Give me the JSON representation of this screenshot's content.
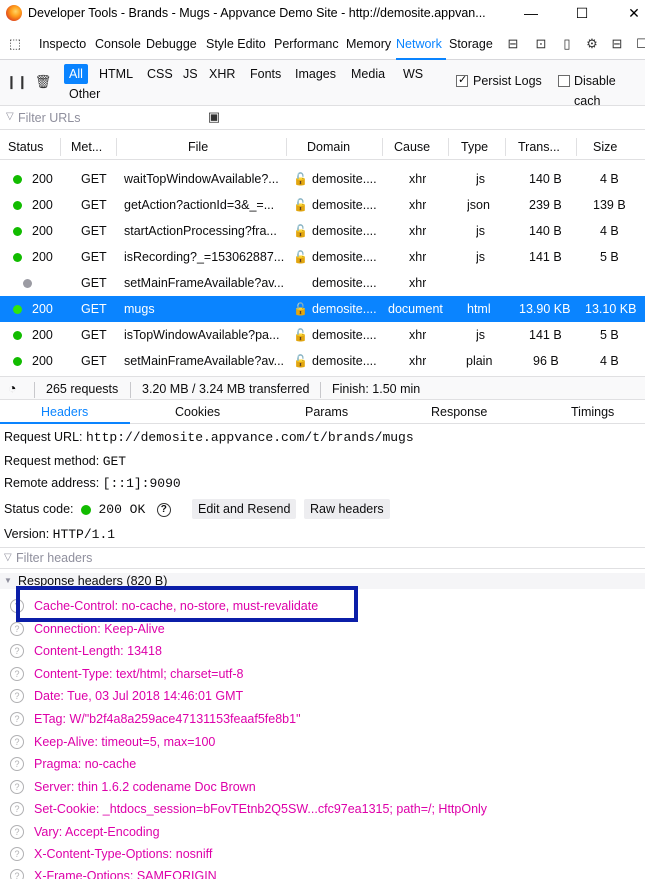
{
  "window": {
    "title": "Developer Tools - Brands - Mugs - Appvance Demo Site - http://demosite.appvan..."
  },
  "toolbox": {
    "tabs": [
      {
        "label": "Inspecto",
        "selected": false
      },
      {
        "label": "Console",
        "selected": false
      },
      {
        "label": "Debugge",
        "selected": false
      },
      {
        "label": "Style Edito",
        "selected": false
      },
      {
        "label": "Performanc",
        "selected": false
      },
      {
        "label": "Memory",
        "selected": false
      },
      {
        "label": "Network",
        "selected": true
      },
      {
        "label": "Storage",
        "selected": false
      }
    ]
  },
  "network_toolbar": {
    "filters": [
      "All",
      "HTML",
      "CSS",
      "JS",
      "XHR",
      "Fonts",
      "Images",
      "Media",
      "WS",
      "Other"
    ],
    "active_filter": "All",
    "persist_logs_label": "Persist Logs",
    "persist_logs_checked": true,
    "disable_cache_label": "Disable cach",
    "disable_cache_checked": false,
    "filter_urls_placeholder": "Filter URLs"
  },
  "columns": [
    "Status",
    "Met...",
    "File",
    "Domain",
    "Cause",
    "Type",
    "Trans...",
    "Size"
  ],
  "requests": [
    {
      "status": "200",
      "method": "GET",
      "file": "waitTopWindowAvailable?...",
      "domain": "demosite....",
      "cause": "xhr",
      "type": "js",
      "transferred": "140 B",
      "size": "4 B",
      "insecure": true,
      "dot": "green",
      "selected": false
    },
    {
      "status": "200",
      "method": "GET",
      "file": "getAction?actionId=3&_=...",
      "domain": "demosite....",
      "cause": "xhr",
      "type": "json",
      "transferred": "239 B",
      "size": "139 B",
      "insecure": true,
      "dot": "green",
      "selected": false
    },
    {
      "status": "200",
      "method": "GET",
      "file": "startActionProcessing?fra...",
      "domain": "demosite....",
      "cause": "xhr",
      "type": "js",
      "transferred": "140 B",
      "size": "4 B",
      "insecure": true,
      "dot": "green",
      "selected": false
    },
    {
      "status": "200",
      "method": "GET",
      "file": "isRecording?_=153062887...",
      "domain": "demosite....",
      "cause": "xhr",
      "type": "js",
      "transferred": "141 B",
      "size": "5 B",
      "insecure": true,
      "dot": "green",
      "selected": false
    },
    {
      "status": "",
      "method": "GET",
      "file": "setMainFrameAvailable?av...",
      "domain": "demosite....",
      "cause": "xhr",
      "type": "",
      "transferred": "",
      "size": "",
      "insecure": false,
      "dot": "grey",
      "selected": false
    },
    {
      "status": "200",
      "method": "GET",
      "file": "mugs",
      "domain": "demosite....",
      "cause": "document",
      "type": "html",
      "transferred": "13.90 KB",
      "size": "13.10 KB",
      "insecure": true,
      "dot": "green",
      "selected": true
    },
    {
      "status": "200",
      "method": "GET",
      "file": "isTopWindowAvailable?pa...",
      "domain": "demosite....",
      "cause": "xhr",
      "type": "js",
      "transferred": "141 B",
      "size": "5 B",
      "insecure": true,
      "dot": "green",
      "selected": false
    },
    {
      "status": "200",
      "method": "GET",
      "file": "setMainFrameAvailable?av...",
      "domain": "demosite....",
      "cause": "xhr",
      "type": "plain",
      "transferred": "96 B",
      "size": "4 B",
      "insecure": true,
      "dot": "green",
      "selected": false
    }
  ],
  "statusbar": {
    "requests": "265 requests",
    "transferred": "3.20 MB / 3.24 MB transferred",
    "finish": "Finish: 1.50 min"
  },
  "details": {
    "tabs": [
      "Headers",
      "Cookies",
      "Params",
      "Response",
      "Timings"
    ],
    "selected_tab": "Headers",
    "request_url_label": "Request URL:",
    "request_url": "http://demosite.appvance.com/t/brands/mugs",
    "request_method_label": "Request method:",
    "request_method": "GET",
    "remote_address_label": "Remote address:",
    "remote_address": "[::1]:9090",
    "status_code_label": "Status code:",
    "status_code": "200 OK",
    "edit_resend_label": "Edit and Resend",
    "raw_headers_label": "Raw headers",
    "version_label": "Version:",
    "version": "HTTP/1.1",
    "filter_headers_placeholder": "Filter headers",
    "response_headers_title": "Response headers (820 B)",
    "response_headers": [
      {
        "name": "Cache-Control:",
        "value": "no-cache, no-store, must-revalidate"
      },
      {
        "name": "Connection:",
        "value": "Keep-Alive"
      },
      {
        "name": "Content-Length:",
        "value": "13418"
      },
      {
        "name": "Content-Type:",
        "value": "text/html; charset=utf-8"
      },
      {
        "name": "Date:",
        "value": "Tue, 03 Jul 2018 14:46:01 GMT"
      },
      {
        "name": "ETag:",
        "value": "W/\"b2f4a8a259ace47131153feaaf5fe8b1\""
      },
      {
        "name": "Keep-Alive:",
        "value": "timeout=5, max=100"
      },
      {
        "name": "Pragma:",
        "value": "no-cache"
      },
      {
        "name": "Server:",
        "value": "thin 1.6.2 codename Doc Brown"
      },
      {
        "name": "Set-Cookie:",
        "value": "_htdocs_session=bFovTEtnb2Q5SW...cfc97ea1315; path=/; HttpOnly"
      },
      {
        "name": "Vary:",
        "value": "Accept-Encoding"
      },
      {
        "name": "X-Content-Type-Options:",
        "value": "nosniff"
      },
      {
        "name": "X-Frame-Options:",
        "value": "SAMEORIGIN"
      }
    ]
  },
  "colors": {
    "accent": "#0a84ff",
    "status_ok": "#12bc00",
    "header_text": "#dd00a9",
    "highlight_box": "#0b1ea8"
  }
}
